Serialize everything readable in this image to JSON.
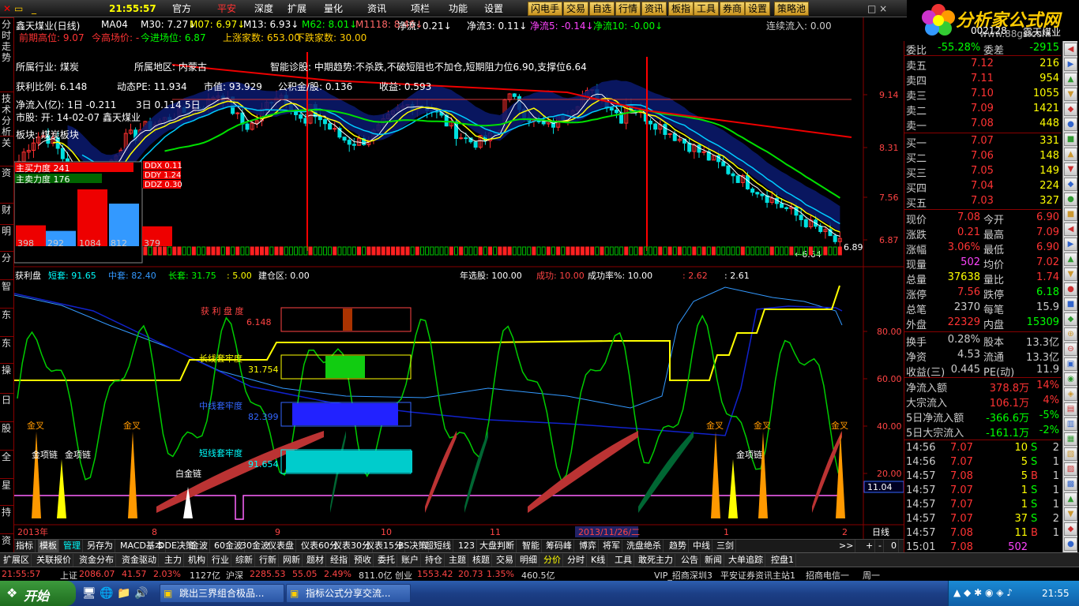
{
  "topbar": {
    "time": "21:55:57",
    "menus": [
      "官方",
      "平安",
      "深度",
      "扩展",
      "量化",
      "资讯",
      "项栏",
      "功能",
      "设置"
    ],
    "buttons": [
      "闪电手",
      "交易",
      "自选",
      "行情",
      "资讯",
      "板指",
      "工具",
      "券商",
      "设置",
      "策略池"
    ]
  },
  "logo": {
    "text": "分析家公式网",
    "url": "www.88gs.com"
  },
  "sidebar": [
    "分时走势",
    "技术分析",
    "关",
    "资",
    "财",
    "明",
    "分",
    "智",
    "东",
    "东",
    "操",
    "日",
    "股",
    "全",
    "星",
    "持",
    "资"
  ],
  "main": {
    "title": "鑫天煤业(日线)",
    "ma": [
      "MA04",
      "M30: 7.27",
      "M07: 6.97",
      "M13: 6.93",
      "M62: 8.01",
      "M1118: 8.46",
      "净流: 0.21",
      "净流3: 0.11",
      "净流5: -0.14",
      "净流10: -0.00"
    ],
    "row2": [
      "前期高位: 9.07",
      "今高场价: -",
      "今进场位: 6.87",
      "上涨家数: 653.00",
      "下跌家数: 30.00"
    ],
    "liuru": "连续流入: 0.00",
    "info1": [
      "所属行业:  煤炭",
      "所属地区:  内蒙古",
      "智能诊股:  中期趋势:不杀跌,不破短阻也不加仓,短期阻力位6.90,支撑位6.64"
    ],
    "info2": [
      "获利比例:  6.148",
      "动态PE:  11.934",
      "市值:  93.929",
      "公积金/股:  0.136",
      "收益:  0.593"
    ],
    "info3": [
      "净流入(亿): 1日  -0.211",
      "3日  0.114",
      "5日"
    ],
    "info4": [
      "市股:   开:  14-02-07 鑫天煤业",
      "  "
    ],
    "info5": [
      "板块:   煤炭板块"
    ],
    "force": [
      "主买力度 241",
      "主卖力度 176"
    ],
    "ddx": [
      "DDX 0.11",
      "DDY 1.24",
      "DDZ 0.30"
    ],
    "bars": [
      {
        "label": "398",
        "v": 398
      },
      {
        "label": "292",
        "v": 292
      },
      {
        "label": "1084",
        "v": 1084
      },
      {
        "label": "812",
        "v": 812
      },
      {
        "label": "379",
        "v": 379
      }
    ],
    "price_ticks": [
      "9.14",
      "8.31",
      "7.56",
      "6.87"
    ],
    "last": "6.89",
    "low": "6.64",
    "lower_header": [
      "获利盘",
      "短套: 91.65",
      "中套: 82.40",
      "长套: 31.75",
      ": 5.00",
      "建仓区: 0.00",
      "年选股: 100.00",
      "成功: 10.00",
      "成功率%: 10.00",
      ": 2.62",
      ": 2.61"
    ],
    "lower_ticks": [
      "80.00",
      "60.00",
      "40.00",
      "20.00",
      "11.04"
    ],
    "boxes": [
      {
        "label": "获 利 盘 度",
        "value": "6.148"
      },
      {
        "label": "长线套牢度",
        "value": "31.754"
      },
      {
        "label": "中线套牢度",
        "value": "82.399"
      },
      {
        "label": "短线套牢度",
        "value": "91.654"
      }
    ],
    "jincha": [
      "金叉",
      "金叉",
      "金叉",
      "金叉",
      "金叉"
    ],
    "lian": [
      "金项链",
      "金项链",
      "白金链",
      "金项链"
    ],
    "dates": [
      "2013年",
      "8",
      "9",
      "10",
      "11",
      "2013/11/26/二",
      "1",
      "2"
    ],
    "period": "日线"
  },
  "tabs": [
    "指标",
    "模板",
    "管理",
    "另存为",
    "MACD基本",
    "DDE决策",
    "金波",
    "60金波",
    "30金波",
    "仪表盘",
    "仪表60分",
    "仪表30分",
    "仪表15分",
    "BS决策",
    "超短线",
    "123",
    "大盘判断",
    "智能",
    "筹码峰",
    "博弈",
    "将军",
    "洗盘绝杀",
    "趋势",
    "中线",
    "三剑"
  ],
  "tabs2": [
    "扩展区",
    "关联报价",
    "资金分布",
    "资金驱动",
    "主力",
    "机构",
    "行业",
    "综新",
    "行新",
    "网新",
    "题材",
    "经指",
    "预收",
    "委托",
    "账户",
    "持仓",
    "主题",
    "核题",
    "交易",
    "明细",
    "分价",
    "分时",
    "K线",
    "工具",
    "敢死主力",
    "公告",
    "新闻",
    "大单追踪",
    "控盘1"
  ],
  "status": {
    "time": "21:55:57",
    "sh": "上证",
    "sh_v": "2086.07",
    "sh_c": "41.57",
    "sh_p": "2.03%",
    "sh_a": "1127亿",
    "sz": "沪深",
    "sz_v": "2285.53",
    "sz_c": "55.05",
    "sz_p": "2.49%",
    "sz_a": "811.0亿",
    "cy": "创业",
    "cy_v": "1553.42",
    "cy_c": "20.73",
    "cy_p": "1.35%",
    "cy_a": "460.5亿",
    "vip": "VIP_招商深圳3",
    "zx": "平安证券资讯主站1",
    "dx": "招商电信一",
    "day": "周一"
  },
  "quote": {
    "code": "002128",
    "name": "露天煤业",
    "weibi_k": "委比",
    "weibi": "-55.28%",
    "weicha_k": "委差",
    "weicha": "-2915",
    "sells": [
      {
        "k": "卖五",
        "p": "7.12",
        "v": "216"
      },
      {
        "k": "卖四",
        "p": "7.11",
        "v": "954"
      },
      {
        "k": "卖三",
        "p": "7.10",
        "v": "1055"
      },
      {
        "k": "卖二",
        "p": "7.09",
        "v": "1421"
      },
      {
        "k": "卖一",
        "p": "7.08",
        "v": "448"
      }
    ],
    "buys": [
      {
        "k": "买一",
        "p": "7.07",
        "v": "331"
      },
      {
        "k": "买二",
        "p": "7.06",
        "v": "148"
      },
      {
        "k": "买三",
        "p": "7.05",
        "v": "149"
      },
      {
        "k": "买四",
        "p": "7.04",
        "v": "224"
      },
      {
        "k": "买五",
        "p": "7.03",
        "v": "327"
      }
    ],
    "stats": [
      [
        "现价",
        "7.08",
        "今开",
        "6.90"
      ],
      [
        "涨跌",
        "0.21",
        "最高",
        "7.09"
      ],
      [
        "涨幅",
        "3.06%",
        "最低",
        "6.90"
      ],
      [
        "现量",
        "502",
        "均价",
        "7.02"
      ],
      [
        "总量",
        "37638",
        "量比",
        "1.74"
      ],
      [
        "涨停",
        "7.56",
        "跌停",
        "6.18"
      ],
      [
        "总笔",
        "2370",
        "每笔",
        "15.9"
      ],
      [
        "外盘",
        "22329",
        "内盘",
        "15309"
      ]
    ],
    "stats2": [
      [
        "换手",
        "0.28%",
        "股本",
        "13.3亿"
      ],
      [
        "净资",
        "4.53",
        "流通",
        "13.3亿"
      ],
      [
        "收益(三)",
        "0.445",
        "PE(动)",
        "11.9"
      ]
    ],
    "flow": [
      [
        "净流入额",
        "378.8万",
        "14%"
      ],
      [
        "大宗流入",
        "106.1万",
        "4%"
      ],
      [
        "5日净流入额",
        "-366.6万",
        "-5%"
      ],
      [
        "5日大宗流入",
        "-161.1万",
        "-2%"
      ]
    ],
    "ticks": [
      [
        "14:56",
        "7.07",
        "10",
        "S",
        "2"
      ],
      [
        "14:56",
        "7.07",
        "5",
        "S",
        "1"
      ],
      [
        "14:57",
        "7.08",
        "5",
        "B",
        "1"
      ],
      [
        "14:57",
        "7.07",
        "1",
        "S",
        "1"
      ],
      [
        "14:57",
        "7.07",
        "1",
        "S",
        "1"
      ],
      [
        "14:57",
        "7.07",
        "37",
        "S",
        "2"
      ],
      [
        "14:57",
        "7.08",
        "11",
        "B",
        "1"
      ],
      [
        "15:01",
        "7.08",
        "502",
        "",
        ""
      ]
    ],
    "bottom_tabs": [
      "笔",
      "价",
      "细",
      "盘",
      "势",
      "指",
      "值",
      "筹"
    ],
    "extra": [
      "拾",
      "换"
    ]
  },
  "taskbar": {
    "start": "开始",
    "tasks": [
      "跳出三界组合极品...",
      "指标公式分享交流..."
    ],
    "clock": "21:55"
  }
}
